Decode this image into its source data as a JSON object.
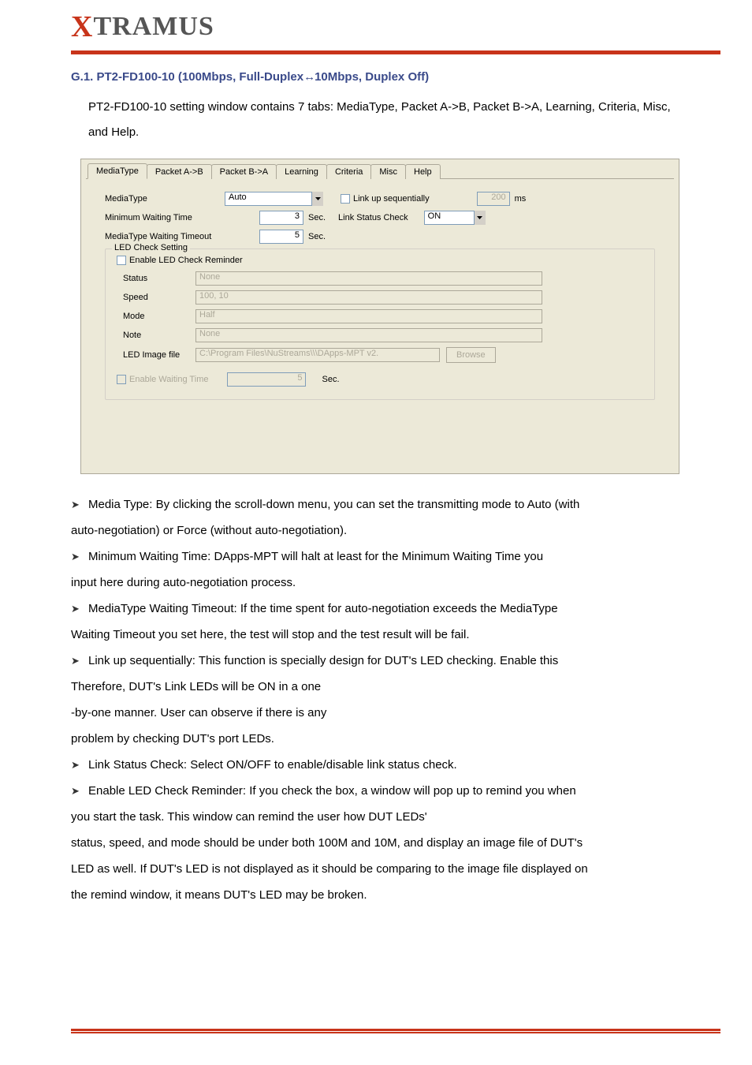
{
  "brand": {
    "x": "X",
    "rest": "TRAMUS"
  },
  "section": {
    "prefix": "G.1. PT2-FD100-10 (100Mbps, Full-Duplex",
    "arrow": "↔",
    "suffix": "10Mbps, Duplex Off)"
  },
  "intro": {
    "text": "PT2-FD100-10 setting window contains 7 tabs: MediaType, Packet A->B, Packet B->A, Learning, Criteria, Misc, and Help."
  },
  "tabs": [
    "MediaType",
    "Packet A->B",
    "Packet B->A",
    "Learning",
    "Criteria",
    "Misc",
    "Help"
  ],
  "form": {
    "mediaType": {
      "label": "MediaType",
      "value": "Auto"
    },
    "linkUpSeq": {
      "label": "Link up sequentially",
      "value": "200",
      "unit": "ms"
    },
    "minWaiting": {
      "label": "Minimum Waiting Time",
      "value": "3",
      "unit": "Sec."
    },
    "linkStatus": {
      "label": "Link Status Check",
      "value": "ON"
    },
    "mediaTypeTimeout": {
      "label": "MediaType Waiting Timeout",
      "value": "5",
      "unit": "Sec."
    },
    "ledGroup": {
      "title": "LED Check Setting",
      "enable": "Enable LED Check Reminder",
      "status": {
        "label": "Status",
        "value": "None"
      },
      "speed": {
        "label": "Speed",
        "value": "100, 10"
      },
      "mode": {
        "label": "Mode",
        "value": "Half"
      },
      "note": {
        "label": "Note",
        "value": "None"
      },
      "image": {
        "label": "LED Image file",
        "value": "C:\\Program Files\\NuStreams\\\\\\DApps-MPT v2.",
        "browse": "Browse"
      },
      "enableWaiting": {
        "label": "Enable Waiting Time",
        "value": "5",
        "unit": "Sec."
      }
    }
  },
  "bullets": {
    "b1a": "Media Type: By clicking the scroll-down menu, you can set the transmitting mode to Auto (with",
    "b1b": "auto-negotiation) or Force (without auto-negotiation).",
    "b2a": "Minimum Waiting Time: DApps-MPT will halt at least for the Minimum Waiting Time you",
    "b2b": "input here during auto-negotiation process.",
    "b3a": "MediaType Waiting Timeout: If the time spent for auto-negotiation exceeds the MediaType",
    "b3b": "Waiting Timeout you set here, the test will stop and the test result will be fail.",
    "b4a": "Link up sequentially: This function is specially design for DUT's LED checking. Enable this",
    "b4b": "Therefore, DUT's Link LEDs will be ON in a one",
    "b4c": "-by-one manner. User can observe if there is any",
    "b4d": "problem by checking DUT's port LEDs.",
    "b5": "Link Status Check: Select ON/OFF to enable/disable link status check.",
    "b6a": "Enable LED Check Reminder: If you check the box, a window will pop up to remind you when",
    "b6b": "you start the task. This window can remind the user how DUT LEDs'",
    "b6c": "status, speed, and mode should be under both 100M and 10M, and display an image file of DUT's",
    "b6d": "LED as well. If DUT's LED is not displayed as it should be comparing to the image file displayed on",
    "b6e": "the remind window, it means DUT's LED may be broken."
  }
}
